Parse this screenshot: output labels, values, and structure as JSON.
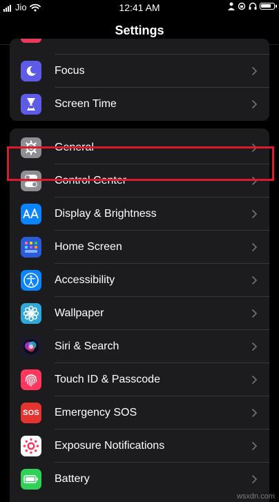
{
  "status_bar": {
    "carrier": "Jio",
    "time": "12:41 AM"
  },
  "nav": {
    "title": "Settings"
  },
  "groups": {
    "top": [
      {
        "label": "Focus",
        "icon": "moon-icon",
        "color": "#5e5ce6"
      },
      {
        "label": "Screen Time",
        "icon": "hourglass-icon",
        "color": "#5e5ce6"
      }
    ],
    "main": [
      {
        "label": "General",
        "icon": "gear-icon",
        "color": "#8e8e93"
      },
      {
        "label": "Control Center",
        "icon": "toggles-icon",
        "color": "#8e8e93"
      },
      {
        "label": "Display & Brightness",
        "icon": "text-size-icon",
        "color": "#0a84ff"
      },
      {
        "label": "Home Screen",
        "icon": "app-grid-icon",
        "color": "#2c5bd8"
      },
      {
        "label": "Accessibility",
        "icon": "accessibility-icon",
        "color": "#0a84ff"
      },
      {
        "label": "Wallpaper",
        "icon": "flower-icon",
        "color": "#30a8d8"
      },
      {
        "label": "Siri & Search",
        "icon": "siri-icon",
        "color": "#1a1a2e"
      },
      {
        "label": "Touch ID & Passcode",
        "icon": "fingerprint-icon",
        "color": "#ff375f"
      },
      {
        "label": "Emergency SOS",
        "icon": "sos-icon",
        "color": "#e5342f"
      },
      {
        "label": "Exposure Notifications",
        "icon": "exposure-icon",
        "color": "#ffffff"
      },
      {
        "label": "Battery",
        "icon": "battery-icon",
        "color": "#30d158"
      }
    ]
  },
  "sos_icon_text": "SOS",
  "watermark": "wsxdn.com",
  "highlight_color": "#e0182b"
}
